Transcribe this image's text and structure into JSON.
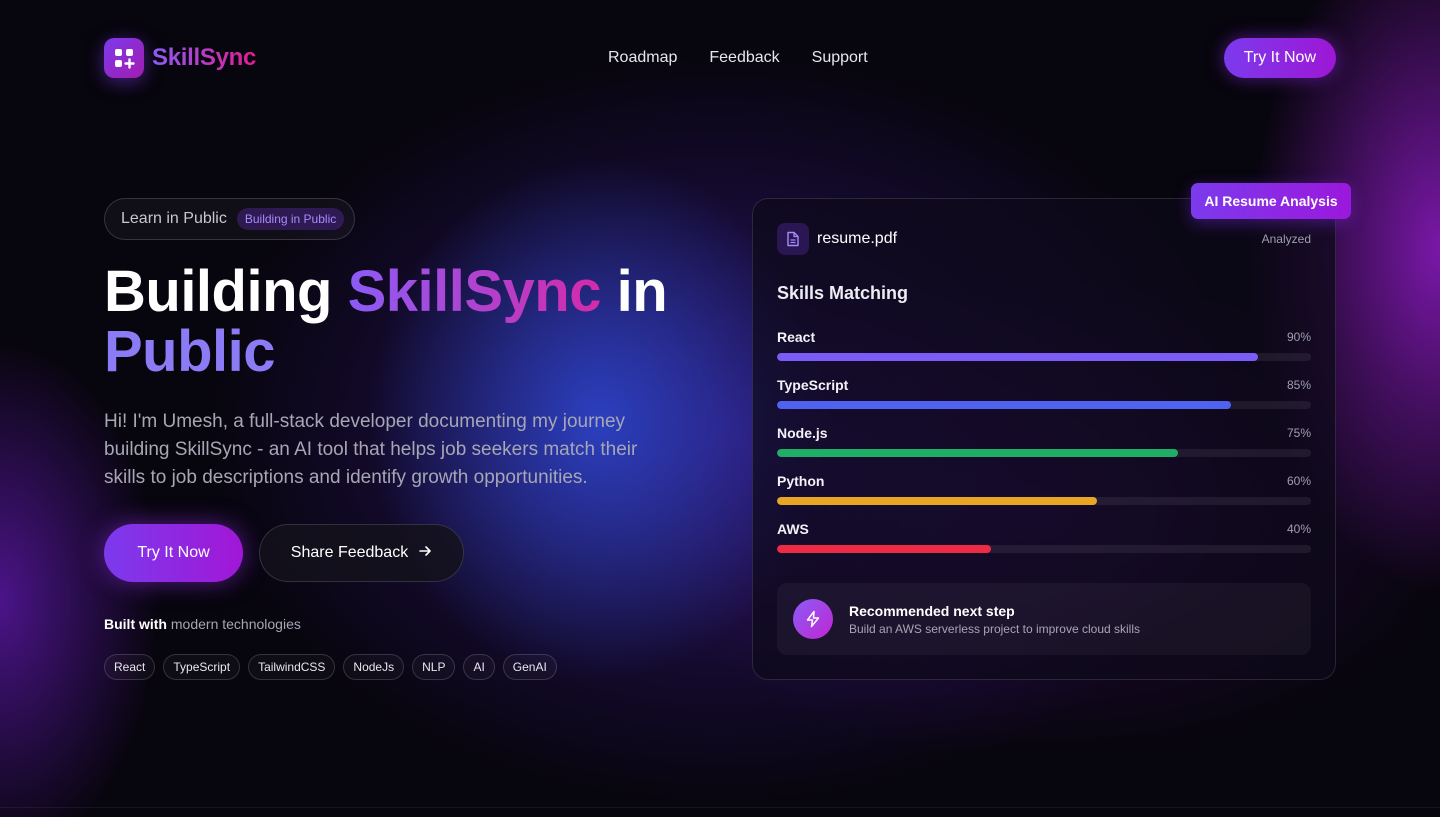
{
  "brand": {
    "name": "SkillSync"
  },
  "nav": {
    "links": [
      "Roadmap",
      "Feedback",
      "Support"
    ],
    "cta": "Try It Now"
  },
  "hero": {
    "pill_text": "Learn in Public",
    "pill_badge": "Building in Public",
    "title_part1": "Building ",
    "title_brand": "SkillSync",
    "title_part2": " in",
    "title_line2": "Public",
    "description": "Hi! I'm Umesh, a full-stack developer documenting my journey building SkillSync - an AI tool that helps job seekers match their skills to job descriptions and identify growth opportunities.",
    "primary_button": "Try It Now",
    "secondary_button": "Share Feedback",
    "secondary_icon": "arrow-right-icon",
    "built_bold": "Built with",
    "built_rest": " modern technologies",
    "tags": [
      "React",
      "TypeScript",
      "TailwindCSS",
      "NodeJs",
      "NLP",
      "AI",
      "GenAI"
    ]
  },
  "card": {
    "badge": "AI Resume Analysis",
    "file_name": "resume.pdf",
    "file_icon": "document-icon",
    "file_status": "Analyzed",
    "skills_title": "Skills Matching",
    "skills": [
      {
        "name": "React",
        "pct_label": "90%",
        "value": 90,
        "color": "#7c5cf6"
      },
      {
        "name": "TypeScript",
        "pct_label": "85%",
        "value": 85,
        "color": "#4f63f0"
      },
      {
        "name": "Node.js",
        "pct_label": "75%",
        "value": 75,
        "color": "#1fae66"
      },
      {
        "name": "Python",
        "pct_label": "60%",
        "value": 60,
        "color": "#e8a623"
      },
      {
        "name": "AWS",
        "pct_label": "40%",
        "value": 40,
        "color": "#ee2a44"
      }
    ],
    "recommendation": {
      "icon": "lightning-icon",
      "title": "Recommended next step",
      "subtitle": "Build an AWS serverless project to improve cloud skills"
    }
  }
}
